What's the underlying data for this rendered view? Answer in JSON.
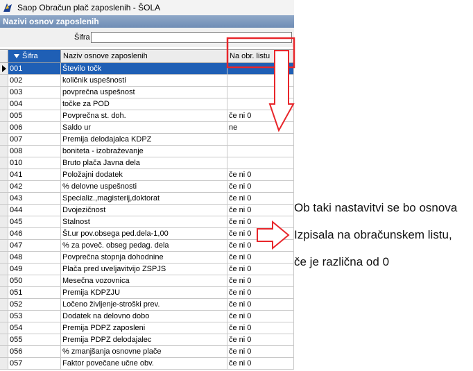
{
  "window": {
    "title": "Saop Obračun plač zaposlenih - ŠOLA",
    "panel_title": "Nazivi osnov zaposlenih"
  },
  "filter": {
    "label": "Šifra",
    "value": ""
  },
  "table": {
    "columns": [
      "Šifra",
      "Naziv osnove zaposlenih",
      "Na obr. listu"
    ],
    "rows": [
      {
        "sifra": "001",
        "naziv": "Število točk",
        "obr": "",
        "selected": true
      },
      {
        "sifra": "002",
        "naziv": "količnik uspešnosti",
        "obr": ""
      },
      {
        "sifra": "003",
        "naziv": "povprečna uspešnost",
        "obr": ""
      },
      {
        "sifra": "004",
        "naziv": "točke za POD",
        "obr": ""
      },
      {
        "sifra": "005",
        "naziv": "Povprečna st. doh.",
        "obr": "če ni 0"
      },
      {
        "sifra": "006",
        "naziv": "Saldo ur",
        "obr": "ne"
      },
      {
        "sifra": "007",
        "naziv": "Premija delodajalca KDPZ",
        "obr": ""
      },
      {
        "sifra": "008",
        "naziv": "boniteta - izobraževanje",
        "obr": ""
      },
      {
        "sifra": "010",
        "naziv": "Bruto plača Javna dela",
        "obr": ""
      },
      {
        "sifra": "041",
        "naziv": "Položajni dodatek",
        "obr": "če ni 0"
      },
      {
        "sifra": "042",
        "naziv": "% delovne  uspešnosti",
        "obr": "če ni 0"
      },
      {
        "sifra": "043",
        "naziv": "Specializ.,magisterij,doktorat",
        "obr": "če ni 0"
      },
      {
        "sifra": "044",
        "naziv": "Dvojezičnost",
        "obr": "če ni 0"
      },
      {
        "sifra": "045",
        "naziv": "Stalnost",
        "obr": "če ni 0"
      },
      {
        "sifra": "046",
        "naziv": "Št.ur pov.obsega ped.dela-1,00",
        "obr": "če ni 0"
      },
      {
        "sifra": "047",
        "naziv": "% za poveč. obseg pedag. dela",
        "obr": "če ni 0"
      },
      {
        "sifra": "048",
        "naziv": "Povprečna stopnja dohodnine",
        "obr": "če ni 0"
      },
      {
        "sifra": "049",
        "naziv": "Plača pred uveljavitvijo ZSPJS",
        "obr": "če ni 0"
      },
      {
        "sifra": "050",
        "naziv": "Mesečna vozovnica",
        "obr": "če ni 0"
      },
      {
        "sifra": "051",
        "naziv": "Premija KDPZJU",
        "obr": "če ni 0"
      },
      {
        "sifra": "052",
        "naziv": "Ločeno življenje-stroški prev.",
        "obr": "če ni 0"
      },
      {
        "sifra": "053",
        "naziv": "Dodatek na delovno dobo",
        "obr": "če ni 0"
      },
      {
        "sifra": "054",
        "naziv": "Premija PDPZ zaposleni",
        "obr": "če ni 0"
      },
      {
        "sifra": "055",
        "naziv": "Premija PDPZ delodajalec",
        "obr": "če ni 0"
      },
      {
        "sifra": "056",
        "naziv": "% zmanjšanja osnovne plače",
        "obr": "če ni 0"
      },
      {
        "sifra": "057",
        "naziv": "Faktor povečane učne obv.",
        "obr": "če ni 0"
      }
    ]
  },
  "annotation": {
    "lines": [
      "Ob taki nastavitvi se bo osnova",
      "Izpisala na obračunskem listu,",
      "če je različna od 0"
    ],
    "highlight_color": "#e8262b"
  },
  "icons": {
    "app": "saop-app-icon",
    "sort": "sort-down-icon",
    "row_indicator": "row-indicator-arrow-icon"
  }
}
